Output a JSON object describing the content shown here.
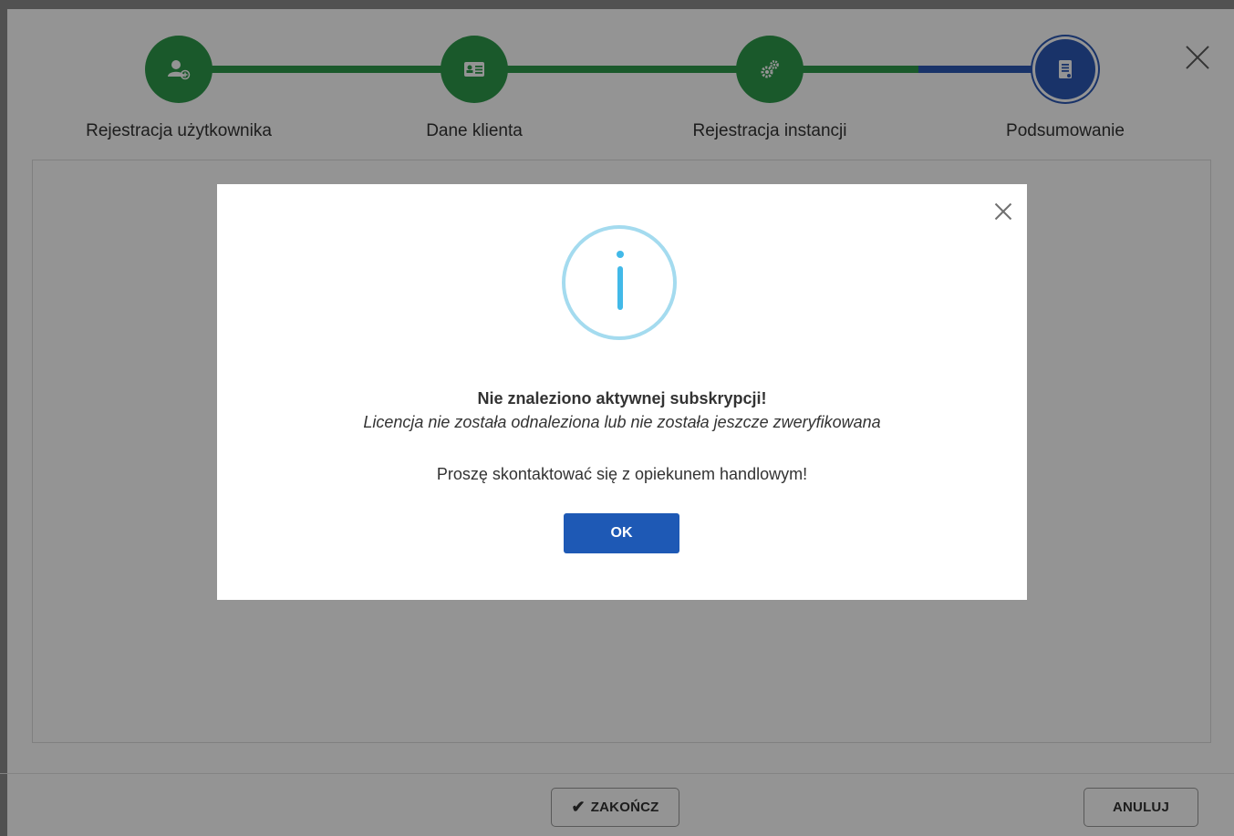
{
  "wizard": {
    "steps": [
      {
        "label": "Rejestracja użytkownika",
        "icon": "user-add-icon",
        "status": "done"
      },
      {
        "label": "Dane klienta",
        "icon": "id-card-icon",
        "status": "done"
      },
      {
        "label": "Rejestracja instancji",
        "icon": "gears-icon",
        "status": "done"
      },
      {
        "label": "Podsumowanie",
        "icon": "document-icon",
        "status": "active"
      }
    ]
  },
  "footer": {
    "finish_label": "ZAKOŃCZ",
    "cancel_label": "ANULUJ"
  },
  "modal": {
    "icon": "info-icon",
    "title": "Nie znaleziono aktywnej subskrypcji!",
    "subtitle": "Licencja nie została odnaleziona lub nie została jeszcze zweryfikowana",
    "message": "Proszę skontaktować się z opiekunem handlowym!",
    "ok_label": "OK"
  },
  "colors": {
    "step_done": "#2e9a4b",
    "step_active": "#2b59b5",
    "primary_button": "#1e59b5",
    "info_accent": "#42b9e8"
  }
}
